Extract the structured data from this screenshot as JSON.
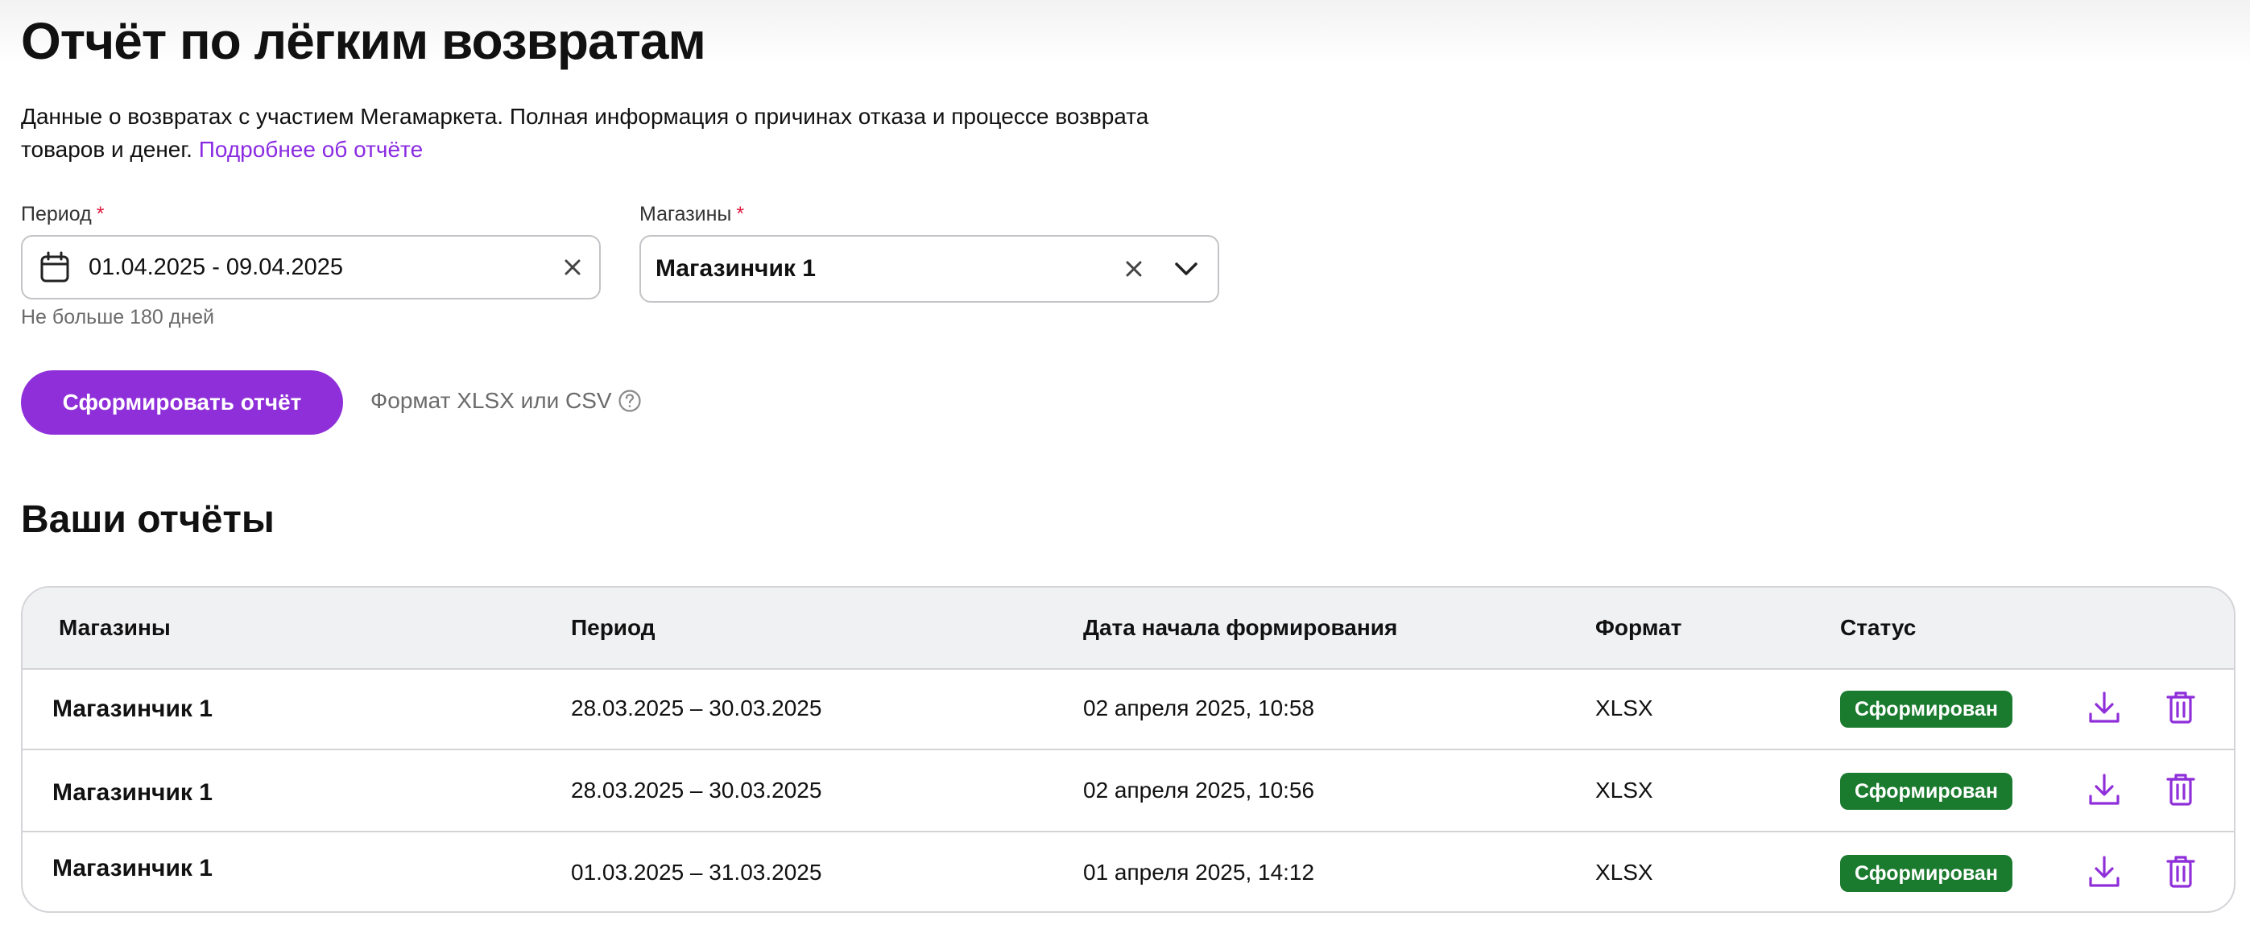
{
  "header": {
    "title": "Отчёт по лёгким возвратам",
    "description": "Данные о возвратах с участием Мегамаркета. Полная информация о причинах отказа и процессе возврата товаров и денег.",
    "more_link": "Подробнее об отчёте"
  },
  "form": {
    "period": {
      "label": "Период",
      "required_mark": "*",
      "value": "01.04.2025 - 09.04.2025",
      "hint": "Не больше 180 дней"
    },
    "shops": {
      "label": "Магазины",
      "required_mark": "*",
      "value": "Магазинчик 1"
    },
    "submit_label": "Сформировать отчёт",
    "format_note": "Формат XLSX или CSV"
  },
  "reports": {
    "title": "Ваши отчёты",
    "columns": {
      "shops": "Магазины",
      "period": "Период",
      "started": "Дата начала формирования",
      "format": "Формат",
      "status": "Статус"
    },
    "rows": [
      {
        "shop": "Магазинчик 1",
        "period": "28.03.2025 – 30.03.2025",
        "started": "02 апреля 2025, 10:58",
        "format": "XLSX",
        "status": "Сформирован"
      },
      {
        "shop": "Магазинчик 1",
        "period": "28.03.2025 – 30.03.2025",
        "started": "02 апреля 2025, 10:56",
        "format": "XLSX",
        "status": "Сформирован"
      },
      {
        "shop": "Магазинчик 1",
        "period": "01.03.2025 – 31.03.2025",
        "started": "01 апреля 2025, 14:12",
        "format": "XLSX",
        "status": "Сформирован"
      }
    ]
  },
  "colors": {
    "accent": "#8f2fd9",
    "link": "#8a2be2",
    "status_done": "#1a7a2e",
    "required": "#e0143c"
  },
  "icons": {
    "period": "calendar-icon",
    "clear": "close-icon",
    "dropdown": "chevron-down-icon",
    "help": "question-circle-icon",
    "download": "download-icon",
    "delete": "trash-icon"
  }
}
